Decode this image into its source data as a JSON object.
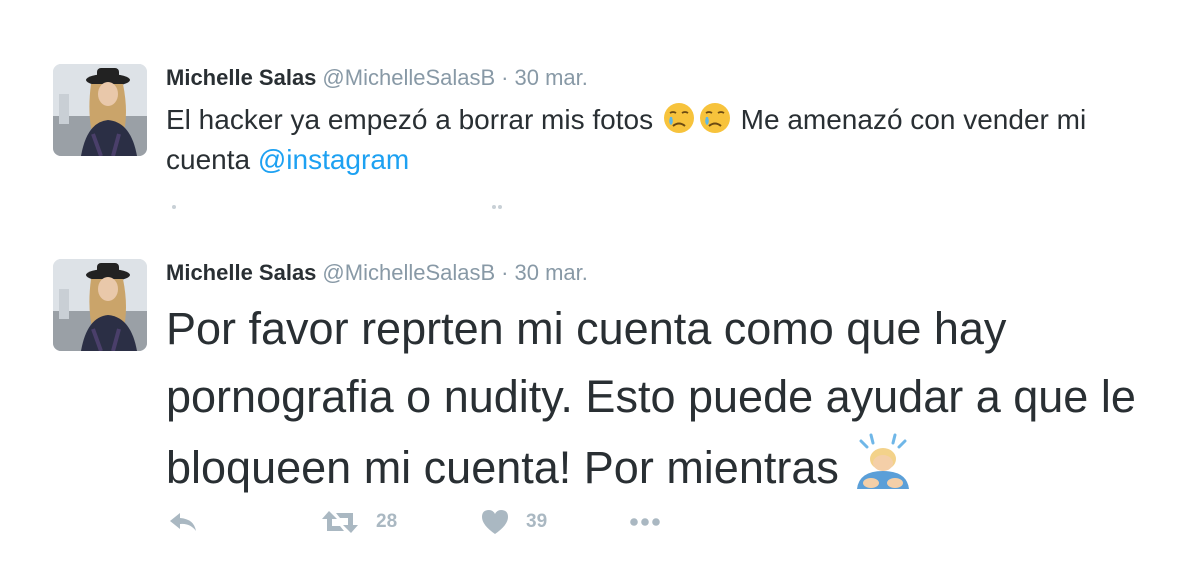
{
  "tweets": [
    {
      "author_name": "Michelle Salas",
      "handle": "@MichelleSalasB",
      "separator": "·",
      "date": "30 mar.",
      "text_1": "El hacker ya empezó a borrar mis fotos",
      "emoji_1": "crying-face-icon",
      "emoji_2": "crying-face-icon",
      "text_2": "Me amenazó con vender mi cuenta",
      "mention": "@instagram"
    },
    {
      "author_name": "Michelle Salas",
      "handle": "@MichelleSalasB",
      "separator": "·",
      "date": "30 mar.",
      "text": "Por favor reprten mi cuenta como que hay pornografia o nudity. Esto puede ayudar a que le bloqueen mi cuenta! Por mientras",
      "emoji": "person-bowing-icon",
      "actions": {
        "reply_icon": "reply-icon",
        "retweet_icon": "retweet-icon",
        "retweet_count": "28",
        "like_icon": "heart-icon",
        "like_count": "39",
        "more_icon": "more-dots-icon"
      }
    }
  ],
  "colors": {
    "text": "#292f33",
    "muted": "#8899a6",
    "link": "#1da1f2",
    "action_icon": "#aab8c2"
  }
}
